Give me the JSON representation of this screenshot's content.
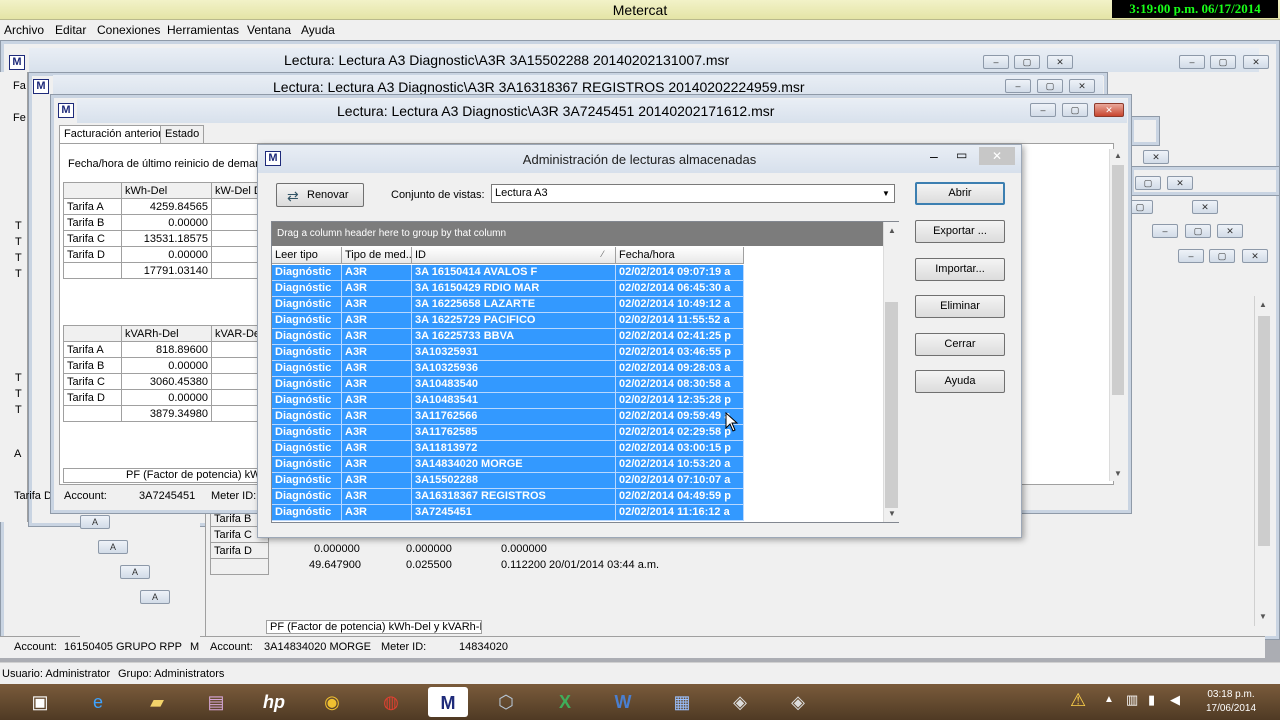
{
  "app": {
    "title": "Metercat",
    "clock": "3:19:00 p.m. 06/17/2014"
  },
  "menu": [
    "Archivo",
    "Editar",
    "Conexiones",
    "Herramientas",
    "Ventana",
    "Ayuda"
  ],
  "windows": {
    "win1_title": "Lectura: Lectura A3 Diagnostic\\A3R 3A15502288 20140202131007.msr",
    "win2_title": "Lectura: Lectura A3 Diagnostic\\A3R 3A16318367 REGISTROS 20140202224959.msr",
    "win3_title": "Lectura: Lectura A3 Diagnostic\\A3R 3A7245451 20140202171612.msr"
  },
  "front_window": {
    "tabs": [
      "Facturación anterior",
      "Estado"
    ],
    "reset_label": "Fecha/hora de último reinicio de demanda",
    "kwh_header": "kWh-Del",
    "kw_header": "kW-Del D",
    "kwh_rows": [
      {
        "label": "Tarifa A",
        "value": "4259.84565"
      },
      {
        "label": "Tarifa B",
        "value": "0.00000"
      },
      {
        "label": "Tarifa C",
        "value": "13531.18575"
      },
      {
        "label": "Tarifa D",
        "value": "0.00000"
      },
      {
        "label": "",
        "value": "17791.03140"
      }
    ],
    "kvarh_header": "kVARh-Del",
    "kvar_header": "kVAR-De",
    "kvarh_rows": [
      {
        "label": "Tarifa A",
        "value": "818.89600"
      },
      {
        "label": "Tarifa B",
        "value": "0.00000"
      },
      {
        "label": "Tarifa C",
        "value": "3060.45380"
      },
      {
        "label": "Tarifa D",
        "value": "0.00000"
      },
      {
        "label": "",
        "value": "3879.34980"
      }
    ],
    "pf_label": "PF (Factor de potencia) kWh-",
    "account_label": "Account:",
    "account_value": "3A7245451",
    "meter_label": "Meter ID:"
  },
  "back_window": {
    "tarifa_b": "Tarifa B",
    "tarifa_c": "Tarifa C",
    "tarifa_d": "Tarifa D",
    "row_d": [
      "0.000000",
      "0.000000",
      "0.000000"
    ],
    "row_total": [
      "49.647900",
      "0.025500",
      "0.112200",
      "20/01/2014 03:44 a.m."
    ],
    "pf_label": "PF (Factor de potencia) kWh-Del y kVARh-Del",
    "account_label": "Account:",
    "account_value": "3A14834020 MORGE",
    "meter_label": "Meter ID:",
    "meter_value": "14834020"
  },
  "left_status": {
    "account_label": "Account:",
    "account_value": "16150405 GRUPO RPP",
    "trailing": "M",
    "tarifa": "Tarifa D",
    "a_label": "A"
  },
  "left_stub_labels": [
    "Fa",
    "Fe",
    "F",
    "T",
    "T",
    "T",
    "T",
    "T",
    "T",
    "T",
    "T",
    "T"
  ],
  "dialog": {
    "title": "Administración de lecturas almacenadas",
    "refresh_label": "Renovar",
    "view_set_label": "Conjunto de vistas:",
    "view_set_value": "Lectura A3",
    "group_hint": "Drag a column header here to group by that column",
    "columns": [
      "Leer tipo",
      "Tipo de med...",
      "ID",
      "Fecha/hora"
    ],
    "rows": [
      {
        "type": "Diagnóstic",
        "meter": "A3R",
        "id": "3A 16150414 AVALOS F",
        "date": "02/02/2014 09:07:19 a"
      },
      {
        "type": "Diagnóstic",
        "meter": "A3R",
        "id": "3A 16150429 RDIO MAR",
        "date": "02/02/2014 06:45:30 a"
      },
      {
        "type": "Diagnóstic",
        "meter": "A3R",
        "id": "3A 16225658 LAZARTE",
        "date": "02/02/2014 10:49:12 a"
      },
      {
        "type": "Diagnóstic",
        "meter": "A3R",
        "id": "3A 16225729 PACIFICO",
        "date": "02/02/2014 11:55:52 a"
      },
      {
        "type": "Diagnóstic",
        "meter": "A3R",
        "id": "3A 16225733 BBVA",
        "date": "02/02/2014 02:41:25 p"
      },
      {
        "type": "Diagnóstic",
        "meter": "A3R",
        "id": "3A10325931",
        "date": "02/02/2014 03:46:55 p"
      },
      {
        "type": "Diagnóstic",
        "meter": "A3R",
        "id": "3A10325936",
        "date": "02/02/2014 09:28:03 a"
      },
      {
        "type": "Diagnóstic",
        "meter": "A3R",
        "id": "3A10483540",
        "date": "02/02/2014 08:30:58 a"
      },
      {
        "type": "Diagnóstic",
        "meter": "A3R",
        "id": "3A10483541",
        "date": "02/02/2014 12:35:28 p"
      },
      {
        "type": "Diagnóstic",
        "meter": "A3R",
        "id": "3A11762566",
        "date": "02/02/2014 09:59:49 a"
      },
      {
        "type": "Diagnóstic",
        "meter": "A3R",
        "id": "3A11762585",
        "date": "02/02/2014 02:29:58 p"
      },
      {
        "type": "Diagnóstic",
        "meter": "A3R",
        "id": "3A11813972",
        "date": "02/02/2014 03:00:15 p"
      },
      {
        "type": "Diagnóstic",
        "meter": "A3R",
        "id": "3A14834020 MORGE",
        "date": "02/02/2014 10:53:20 a"
      },
      {
        "type": "Diagnóstic",
        "meter": "A3R",
        "id": "3A15502288",
        "date": "02/02/2014 07:10:07 a"
      },
      {
        "type": "Diagnóstic",
        "meter": "A3R",
        "id": "3A16318367 REGISTROS",
        "date": "02/02/2014 04:49:59 p"
      },
      {
        "type": "Diagnóstic",
        "meter": "A3R",
        "id": "3A7245451",
        "date": "02/02/2014 11:16:12 a"
      }
    ],
    "buttons": {
      "open": "Abrir",
      "export": "Exportar ...",
      "import": "Importar...",
      "delete": "Eliminar",
      "close": "Cerrar",
      "help": "Ayuda"
    }
  },
  "status_bar": {
    "user": "Usuario: Administrator",
    "group": "Grupo: Administrators"
  },
  "taskbar": {
    "icons": [
      "app-icon",
      "ie-icon",
      "folder-icon",
      "media-icon",
      "hp-icon",
      "app-gold-icon",
      "chrome-icon",
      "metercat-icon",
      "box-icon",
      "excel-icon",
      "word-icon",
      "network-icon",
      "tool-icon",
      "tool2-icon"
    ],
    "time": "03:18 p.m.",
    "date": "17/06/2014"
  }
}
